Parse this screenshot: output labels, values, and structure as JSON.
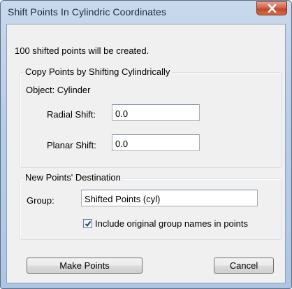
{
  "window": {
    "title": "Shift Points In Cylindric Coordinates"
  },
  "info": {
    "message": "100 shifted points will be created."
  },
  "copy_group": {
    "legend": "Copy Points by Shifting Cylindrically",
    "object_label": "Object: Cylinder",
    "radial_label": "Radial Shift:",
    "radial_value": "0.0",
    "planar_label": "Planar Shift:",
    "planar_value": "0.0"
  },
  "dest_group": {
    "legend": "New Points' Destination",
    "group_label": "Group:",
    "group_value": "Shifted Points (cyl)",
    "include_checked": true,
    "include_label": "Include original group names in points"
  },
  "buttons": {
    "make_points": "Make Points",
    "cancel": "Cancel"
  },
  "icons": {
    "close": "close-icon",
    "checkmark": "checkmark-icon"
  }
}
